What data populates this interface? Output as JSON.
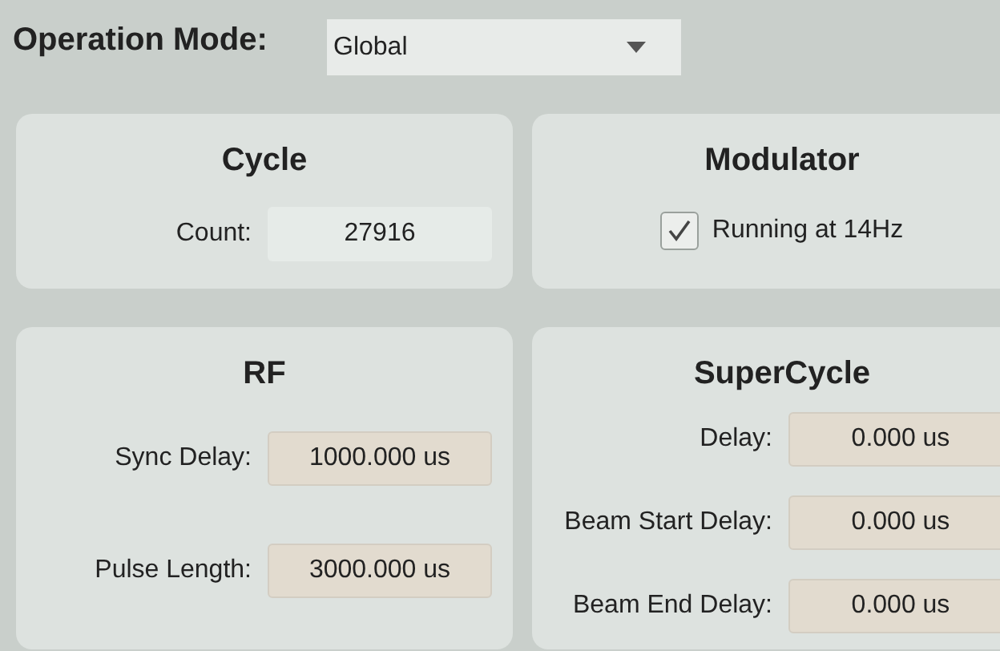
{
  "operation_mode": {
    "label": "Operation Mode:",
    "value": "Global"
  },
  "panels": [
    {
      "title": "Cycle",
      "kind": "fields",
      "fields": [
        {
          "label": "Count:",
          "value": "27916",
          "editable": false
        }
      ]
    },
    {
      "title": "Modulator",
      "kind": "checkbox",
      "checkbox": {
        "label": "Running at 14Hz",
        "checked": true
      }
    },
    {
      "title": "RF",
      "kind": "fields",
      "fields": [
        {
          "label": "Sync Delay:",
          "value": "1000.000 us",
          "editable": true
        },
        {
          "label": "Pulse Length:",
          "value": "3000.000 us",
          "editable": true
        }
      ]
    },
    {
      "title": "SuperCycle",
      "kind": "fields",
      "fields": [
        {
          "label": "Delay:",
          "value": "0.000 us",
          "editable": true
        },
        {
          "label": "Beam Start Delay:",
          "value": "0.000 us",
          "editable": true
        },
        {
          "label": "Beam End Delay:",
          "value": "0.000 us",
          "editable": true
        }
      ]
    }
  ]
}
